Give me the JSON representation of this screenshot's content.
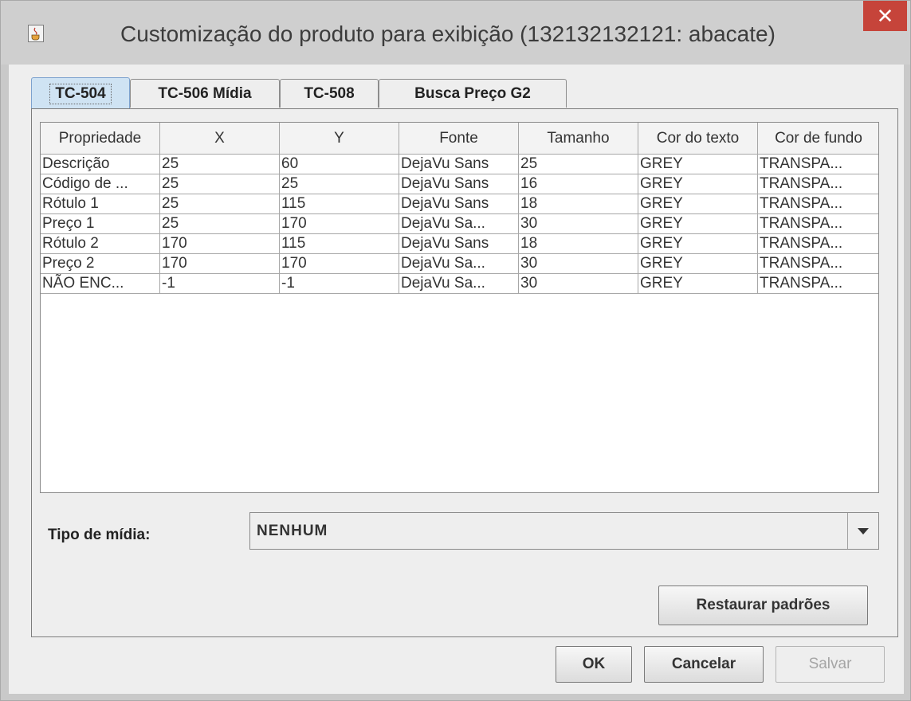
{
  "window": {
    "title": "Customização do produto para exibição (132132132121: abacate)",
    "close_glyph": "✕"
  },
  "tabs": [
    {
      "label": "TC-504",
      "active": true
    },
    {
      "label": "TC-506 Mídia",
      "active": false
    },
    {
      "label": "TC-508",
      "active": false
    },
    {
      "label": "Busca Preço G2",
      "active": false
    }
  ],
  "table": {
    "columns": [
      "Propriedade",
      "X",
      "Y",
      "Fonte",
      "Tamanho",
      "Cor do texto",
      "Cor de fundo"
    ],
    "rows": [
      [
        "Descrição",
        "25",
        "60",
        "DejaVu Sans",
        "25",
        "GREY",
        "TRANSPA..."
      ],
      [
        "Código de ...",
        "25",
        "25",
        "DejaVu Sans",
        "16",
        "GREY",
        "TRANSPA..."
      ],
      [
        "Rótulo 1",
        "25",
        "115",
        "DejaVu Sans",
        "18",
        "GREY",
        "TRANSPA..."
      ],
      [
        "Preço 1",
        "25",
        "170",
        "DejaVu Sa...",
        "30",
        "GREY",
        "TRANSPA..."
      ],
      [
        "Rótulo 2",
        "170",
        "115",
        "DejaVu Sans",
        "18",
        "GREY",
        "TRANSPA..."
      ],
      [
        "Preço 2",
        "170",
        "170",
        "DejaVu Sa...",
        "30",
        "GREY",
        "TRANSPA..."
      ],
      [
        "NÃO ENC...",
        "-1",
        "-1",
        "DejaVu Sa...",
        "30",
        "GREY",
        "TRANSPA..."
      ]
    ]
  },
  "media": {
    "label": "Tipo de mídia:",
    "value": "NENHUM"
  },
  "buttons": {
    "restore": "Restaurar padrões",
    "ok": "OK",
    "cancel": "Cancelar",
    "save": "Salvar"
  },
  "colors": {
    "active_tab": "#cfe3f3",
    "close_button": "#c6443a"
  },
  "icons": {
    "app": "java-cup-icon",
    "close": "close-icon",
    "dropdown": "triangle-down-icon"
  }
}
